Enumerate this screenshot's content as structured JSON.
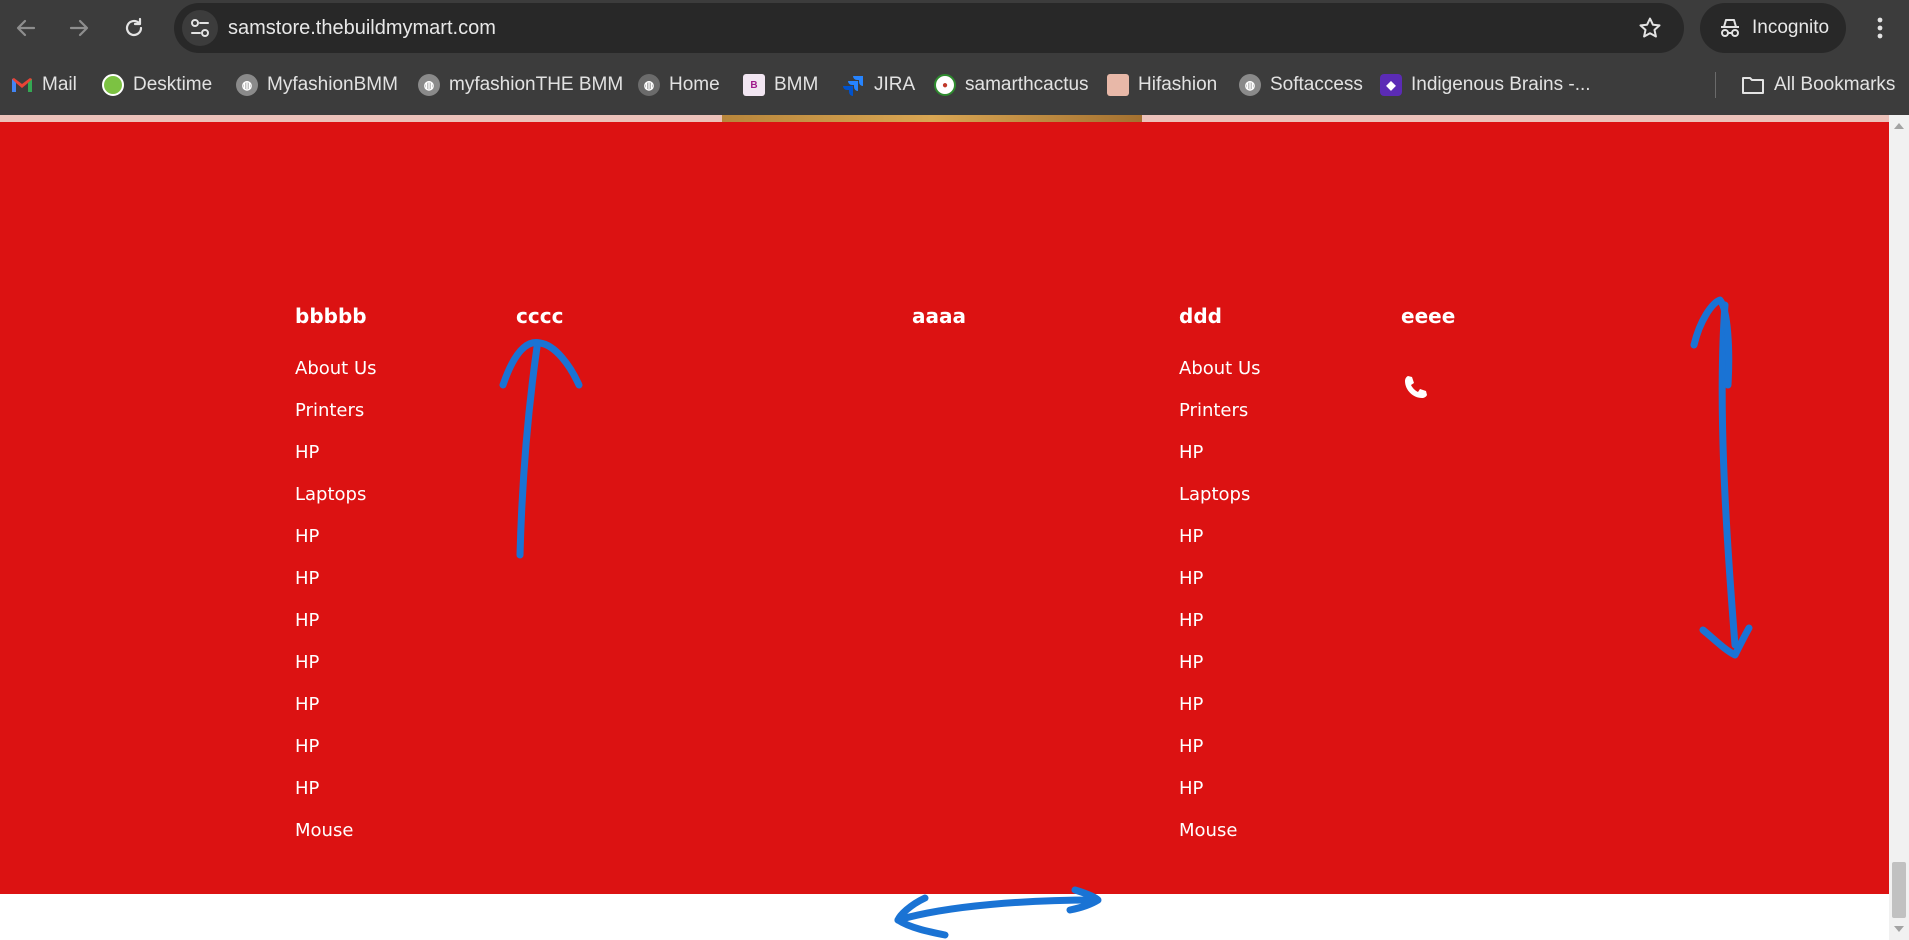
{
  "browser": {
    "url": "samstore.thebuildmymart.com",
    "profile_label": "Incognito",
    "bookmarks": [
      {
        "label": "Mail",
        "icon": "gmail-icon"
      },
      {
        "label": "Desktime",
        "icon": "desktime-icon"
      },
      {
        "label": "MyfashionBMM",
        "icon": "globe-icon"
      },
      {
        "label": "myfashionTHE BMM",
        "icon": "globe-icon"
      },
      {
        "label": "Home",
        "icon": "globe-icon"
      },
      {
        "label": "BMM",
        "icon": "bmm-icon"
      },
      {
        "label": "JIRA",
        "icon": "jira-icon"
      },
      {
        "label": "samarthcactus",
        "icon": "cactus-icon"
      },
      {
        "label": "Hifashion",
        "icon": "hifashion-icon"
      },
      {
        "label": "Softaccess",
        "icon": "globe-icon"
      },
      {
        "label": "Indigenous Brains -...",
        "icon": "indigenous-brains-icon"
      }
    ],
    "all_bookmarks_label": "All Bookmarks"
  },
  "footer": {
    "background": "#dc1212",
    "columns": [
      {
        "title": "bbbbb",
        "links": [
          "About Us",
          "Printers",
          "HP",
          "Laptops",
          "HP",
          "HP",
          "HP",
          "HP",
          "HP",
          "HP",
          "HP",
          "Mouse"
        ]
      },
      {
        "title": "cccc",
        "links": []
      },
      {
        "title": "aaaa",
        "links": []
      },
      {
        "title": "ddd",
        "links": [
          "About Us",
          "Printers",
          "HP",
          "Laptops",
          "HP",
          "HP",
          "HP",
          "HP",
          "HP",
          "HP",
          "HP",
          "Mouse"
        ]
      },
      {
        "title": "eeee",
        "icon": "phone-icon"
      }
    ]
  },
  "annotation_color": "#1a73d4"
}
